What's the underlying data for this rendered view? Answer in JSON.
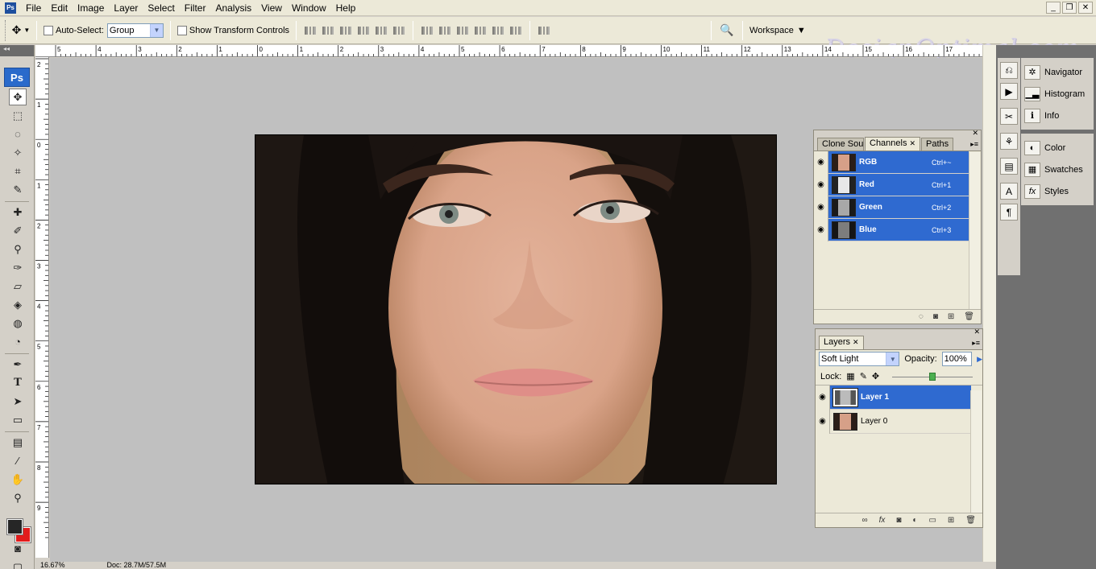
{
  "menubar": {
    "app_icon": "Ps",
    "items": [
      "File",
      "Edit",
      "Image",
      "Layer",
      "Select",
      "Filter",
      "Analysis",
      "View",
      "Window",
      "Help"
    ]
  },
  "options_bar": {
    "auto_select_label": "Auto-Select:",
    "auto_select_value": "Group",
    "show_transform_label": "Show Transform Controls",
    "workspace_label": "Workspace",
    "watermark": "DesignOptimal.com"
  },
  "toolbox": {
    "logo": "Ps",
    "colors": {
      "foreground": "#262626",
      "background": "#e21c1c"
    }
  },
  "rulers": {
    "horizontal_labels": [
      "5",
      "4",
      "3",
      "2",
      "1",
      "0",
      "1",
      "2",
      "3",
      "4",
      "5",
      "6",
      "7",
      "8",
      "9",
      "10",
      "11",
      "12",
      "13",
      "14",
      "15",
      "16",
      "17"
    ],
    "vertical_labels": [
      "2",
      "1",
      "0",
      "1",
      "2",
      "3",
      "4",
      "5",
      "6",
      "7",
      "8",
      "9"
    ]
  },
  "status_bar": {
    "zoom": "16.67%",
    "doc": "Doc: 28.7M/57.5M"
  },
  "dock": {
    "group1": [
      "Navigator",
      "Histogram",
      "Info"
    ],
    "group2": [
      "Color",
      "Swatches",
      "Styles"
    ]
  },
  "channels_panel": {
    "tabs": [
      "Clone Source",
      "Channels",
      "Paths"
    ],
    "active_tab": "Channels",
    "channels": [
      {
        "name": "RGB",
        "shortcut": "Ctrl+~"
      },
      {
        "name": "Red",
        "shortcut": "Ctrl+1"
      },
      {
        "name": "Green",
        "shortcut": "Ctrl+2"
      },
      {
        "name": "Blue",
        "shortcut": "Ctrl+3"
      }
    ]
  },
  "layers_panel": {
    "tab": "Layers",
    "blend_mode": "Soft Light",
    "opacity_label": "Opacity:",
    "opacity_value": "100%",
    "lock_label": "Lock:",
    "layers": [
      {
        "name": "Layer 1",
        "selected": true
      },
      {
        "name": "Layer 0",
        "selected": false
      }
    ]
  },
  "colors": {
    "selection": "#2f6ad0",
    "canvas_bg": "#c0c0c0"
  }
}
